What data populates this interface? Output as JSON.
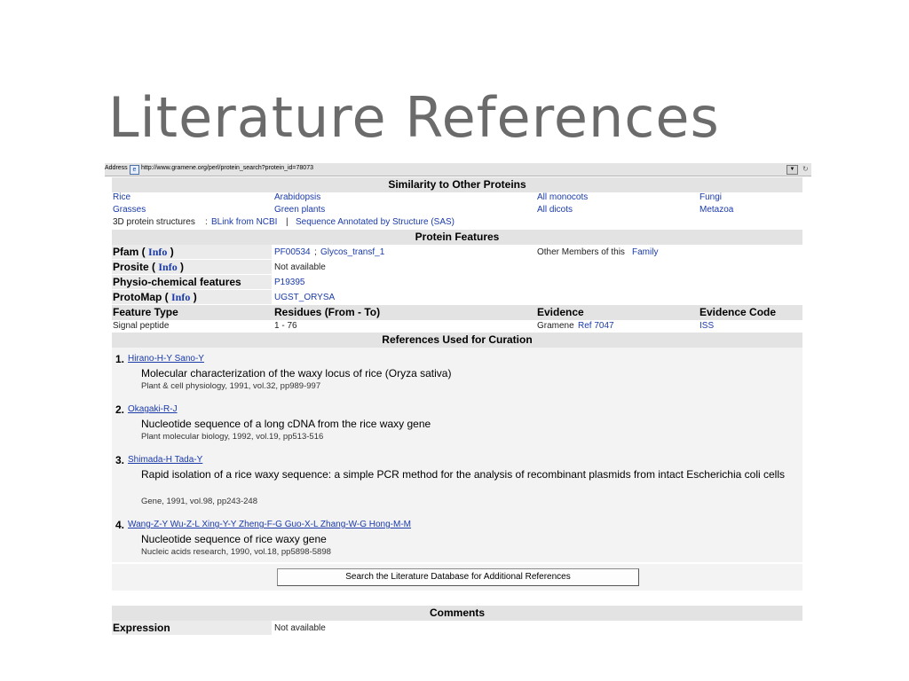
{
  "slide": {
    "title": "Literature References"
  },
  "browser": {
    "address_label": "Address",
    "url": "http://www.gramene.org/perl/protein_search?protein_id=78073"
  },
  "similarity": {
    "header": "Similarity to Other Proteins",
    "row1": [
      "Rice",
      "Arabidopsis",
      "All monocots",
      "Fungi"
    ],
    "row2": [
      "Grasses",
      "Green plants",
      "All dicots",
      "Metazoa"
    ],
    "structures_label": "3D protein structures",
    "structures_colon": ":",
    "blink_link": "BLink from NCBI",
    "separator": "|",
    "sas_link": "Sequence Annotated by Structure (SAS)"
  },
  "features": {
    "header": "Protein Features",
    "pfam_label": "Pfam (",
    "info": "Info",
    "close_paren": ")",
    "pfam_id": "PF00534",
    "pfam_sep": ";",
    "pfam_name": "Glycos_transf_1",
    "other_members_text": "Other Members of this",
    "family_link": "Family",
    "prosite_label": "Prosite (",
    "prosite_value": "Not available",
    "physio_label": "Physio-chemical features",
    "physio_value": "P19395",
    "protomap_label": "ProtoMap (",
    "protomap_value": "UGST_ORYSA"
  },
  "feature_table": {
    "headers": [
      "Feature Type",
      "Residues (From - To)",
      "Evidence",
      "Evidence Code"
    ],
    "row": {
      "type": "Signal peptide",
      "residues": "1 - 76",
      "evidence_text": "Gramene",
      "evidence_link": "Ref 7047",
      "code": "ISS"
    }
  },
  "references": {
    "header": "References Used for Curation",
    "items": [
      {
        "num": "1.",
        "authors": "Hirano-H-Y Sano-Y",
        "title": "Molecular characterization of the waxy locus of rice (Oryza sativa)",
        "source": "Plant & cell physiology, 1991, vol.32, pp989-997"
      },
      {
        "num": "2.",
        "authors": "Okagaki-R-J",
        "title": "Nucleotide sequence of a long cDNA from the rice waxy gene",
        "source": "Plant molecular biology, 1992, vol.19, pp513-516"
      },
      {
        "num": "3.",
        "authors": "Shimada-H Tada-Y",
        "title": "Rapid isolation of a rice waxy sequence: a simple PCR method for the analysis of recombinant plasmids from intact Escherichia coli cells",
        "source": "Gene, 1991, vol.98, pp243-248"
      },
      {
        "num": "4.",
        "authors": "Wang-Z-Y Wu-Z-L Xing-Y-Y Zheng-F-G Guo-X-L Zhang-W-G Hong-M-M",
        "title": "Nucleotide sequence of rice waxy gene",
        "source": "Nucleic acids research, 1990, vol.18, pp5898-5898"
      }
    ],
    "search_button": "Search the Literature Database for Additional References"
  },
  "comments": {
    "header": "Comments",
    "expression_label": "Expression",
    "expression_value": "Not available"
  },
  "colors": {
    "link": "#1a3aaa",
    "header_bg": "#e3e3e3",
    "title": "#6b6b6b"
  }
}
